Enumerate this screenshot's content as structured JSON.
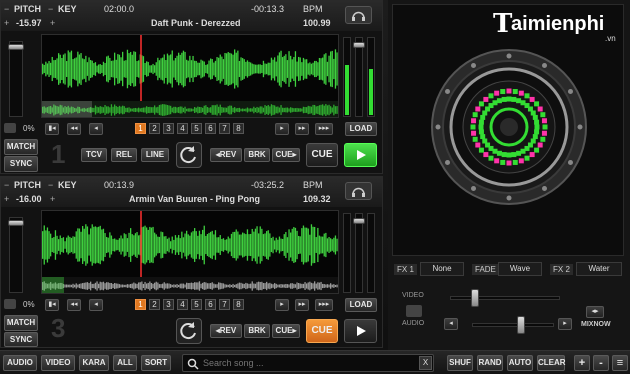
{
  "deckA": {
    "pitch_label": "PITCH",
    "key_label": "KEY",
    "pitch_value": "-15.97",
    "elapsed": "02:00.0",
    "remaining": "-00:13.3",
    "bpm_label": "BPM",
    "bpm": "100.99",
    "title": "Daft Punk - Derezzed",
    "lock_pct": "0%",
    "deck_number": "1",
    "cue_pads": [
      "1",
      "2",
      "3",
      "4",
      "5",
      "6",
      "7",
      "8"
    ],
    "load_label": "LOAD",
    "match_label": "MATCH",
    "sync_label": "SYNC",
    "tcv_label": "TCV",
    "rel_label": "REL",
    "line_label": "LINE",
    "rev_label": "REV",
    "brk_label": "BRK",
    "cue_small_label": "CUE",
    "cue_label": "CUE",
    "play_icon": "play-icon"
  },
  "deckB": {
    "pitch_label": "PITCH",
    "key_label": "KEY",
    "pitch_value": "-16.00",
    "elapsed": "00:13.9",
    "remaining": "-03:25.2",
    "bpm_label": "BPM",
    "bpm": "109.32",
    "title": "Armin Van Buuren - Ping Pong",
    "lock_pct": "0%",
    "deck_number": "3",
    "cue_pads": [
      "1",
      "2",
      "3",
      "4",
      "5",
      "6",
      "7",
      "8"
    ],
    "load_label": "LOAD",
    "match_label": "MATCH",
    "sync_label": "SYNC",
    "rev_label": "REV",
    "brk_label": "BRK",
    "cue_small_label": "CUE",
    "cue_label": "CUE",
    "play_icon": "play-icon"
  },
  "mixer": {
    "fx1_label": "FX 1",
    "fx1_value": "None",
    "fade_label": "FADE",
    "fade_value": "Wave",
    "fx2_label": "FX 2",
    "fx2_value": "Water",
    "video_label": "VIDEO",
    "audio_label": "AUDIO",
    "mixnow_label": "MIXNOW"
  },
  "logo": {
    "brand": "aimienphi",
    "brand_initial": "T",
    "domain": ".vn"
  },
  "bottom": {
    "audio": "AUDIO",
    "video": "VIDEO",
    "kara": "KARA",
    "all": "ALL",
    "sort": "SORT",
    "search_placeholder": "Search song ...",
    "clear_x": "X",
    "shuf": "SHUF",
    "rand": "RAND",
    "auto": "AUTO",
    "clear": "CLEAR",
    "plus": "+",
    "minus": "-",
    "menu": "≡"
  },
  "colors": {
    "waveform": "#3fcf3f",
    "accent_orange": "#e07820",
    "play_green": "#2ecc2e",
    "vu_green": "#33dd33",
    "platter_pink": "#ff33aa"
  }
}
